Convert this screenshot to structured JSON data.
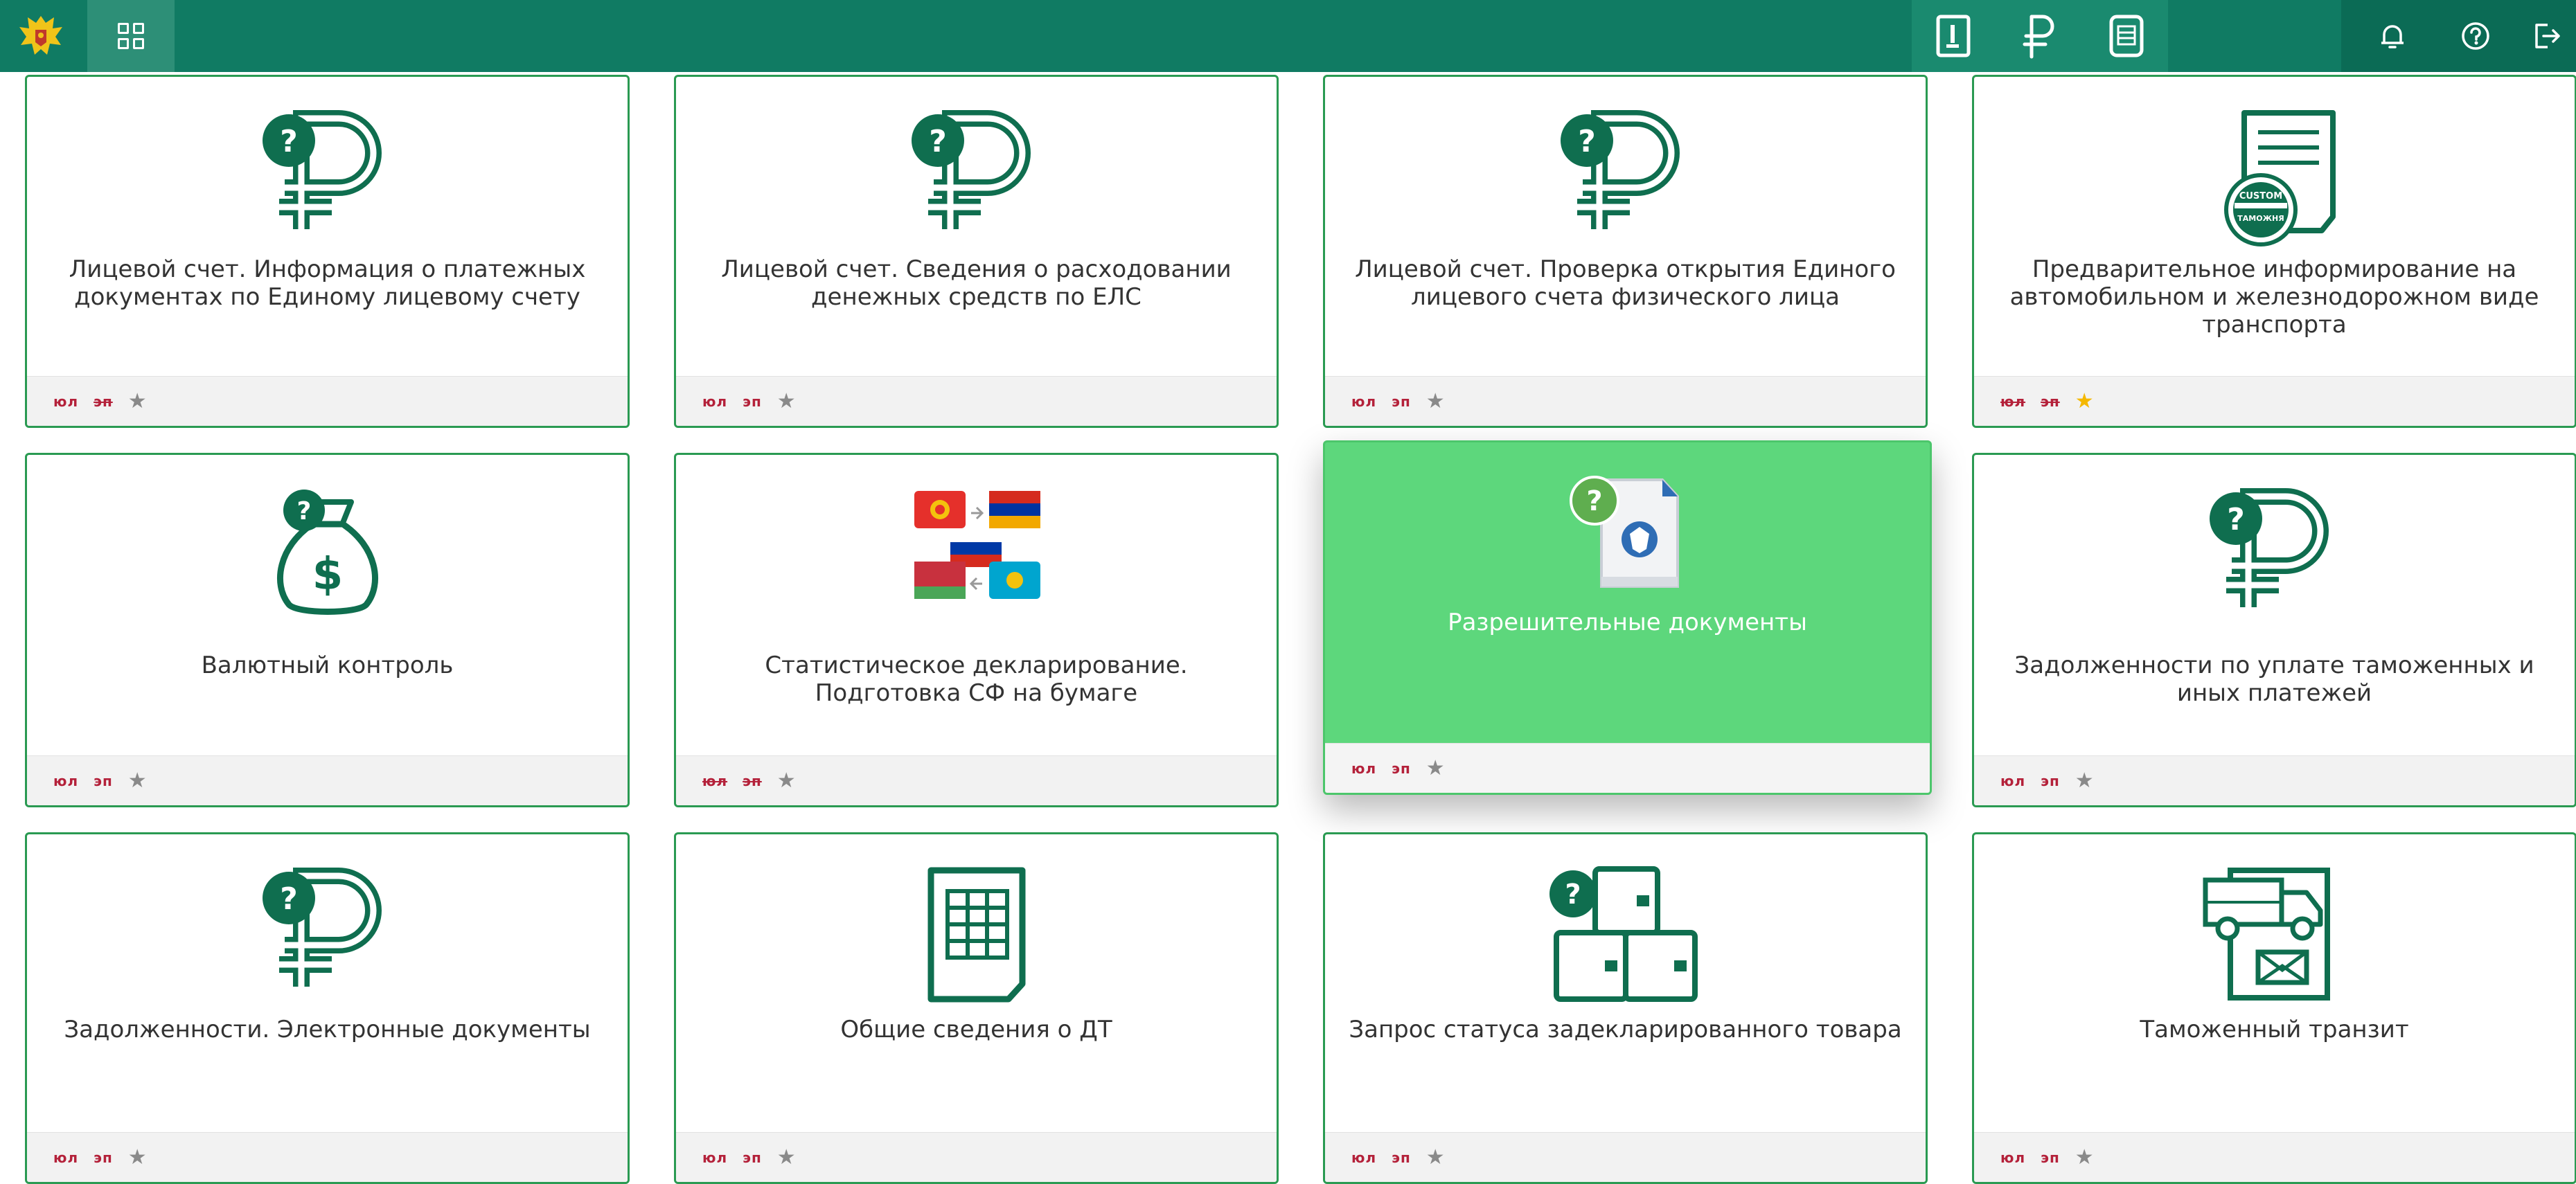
{
  "header": {
    "emblem_icon": "customs-eagle-emblem-icon",
    "apps_icon": "grid-apps-icon",
    "mid_icons": [
      "reference-book-icon",
      "ruble-icon",
      "document-list-icon"
    ],
    "right_icons": [
      "bell-icon",
      "help-icon",
      "logout-icon"
    ]
  },
  "colors": {
    "brand": "#107b63",
    "tile_border": "#2a9a52",
    "tile_active": "#5dd77c",
    "icon_green": "#0f6e4f",
    "badge_red": "#b4213a",
    "star_gold": "#f5b800"
  },
  "tiles": [
    {
      "title": "Лицевой счет. Информация о платежных документах по Единому лицевому счету",
      "icon": "ruble-question-icon",
      "badge1": "юл",
      "badge2": "эп",
      "badge1_struck": false,
      "badge2_struck": true,
      "starred": false
    },
    {
      "title": "Лицевой счет. Сведения о расходовании денежных средств по ЕЛС",
      "icon": "ruble-question-icon",
      "badge1": "юл",
      "badge2": "эп",
      "badge1_struck": false,
      "badge2_struck": false,
      "starred": false
    },
    {
      "title": "Лицевой счет. Проверка открытия Единого лицевого счета физического лица",
      "icon": "ruble-question-icon",
      "badge1": "юл",
      "badge2": "эп",
      "badge1_struck": false,
      "badge2_struck": false,
      "starred": false
    },
    {
      "title": "Предварительное информирование на автомобильном и железнодорожном виде транспорта",
      "icon": "customs-stamp-document-icon",
      "badge1": "юл",
      "badge2": "эп",
      "badge1_struck": true,
      "badge2_struck": true,
      "starred": true,
      "stamp_line1": "CUSTOM",
      "stamp_line2": "ТАМОЖНЯ"
    },
    {
      "title": "Валютный контроль",
      "icon": "money-bag-question-icon",
      "badge1": "юл",
      "badge2": "эп",
      "badge1_struck": false,
      "badge2_struck": false,
      "starred": false
    },
    {
      "title": "Статистическое декларирование. Подготовка СФ на бумаге",
      "icon": "eaeu-flags-icon",
      "badge1": "юл",
      "badge2": "эп",
      "badge1_struck": true,
      "badge2_struck": true,
      "starred": false
    },
    {
      "title": "Разрешительные документы",
      "icon": "permit-document-question-icon",
      "badge1": "юл",
      "badge2": "эп",
      "badge1_struck": false,
      "badge2_struck": false,
      "starred": false,
      "active": true
    },
    {
      "title": "Задолженности по уплате таможенных и иных платежей",
      "icon": "ruble-question-icon",
      "badge1": "юл",
      "badge2": "эп",
      "badge1_struck": false,
      "badge2_struck": false,
      "starred": false
    },
    {
      "title": "Задолженности. Электронные документы",
      "icon": "ruble-question-icon",
      "badge1": "юл",
      "badge2": "эп",
      "badge1_struck": false,
      "badge2_struck": false,
      "starred": false
    },
    {
      "title": "Общие сведения о ДТ",
      "icon": "declaration-table-icon",
      "badge1": "юл",
      "badge2": "эп",
      "badge1_struck": false,
      "badge2_struck": false,
      "starred": false
    },
    {
      "title": "Запрос статуса задекларированного товара",
      "icon": "boxes-question-icon",
      "badge1": "юл",
      "badge2": "эп",
      "badge1_struck": false,
      "badge2_struck": false,
      "starred": false
    },
    {
      "title": "Таможенный транзит",
      "icon": "truck-transit-document-icon",
      "badge1": "юл",
      "badge2": "эп",
      "badge1_struck": false,
      "badge2_struck": false,
      "starred": false
    }
  ]
}
